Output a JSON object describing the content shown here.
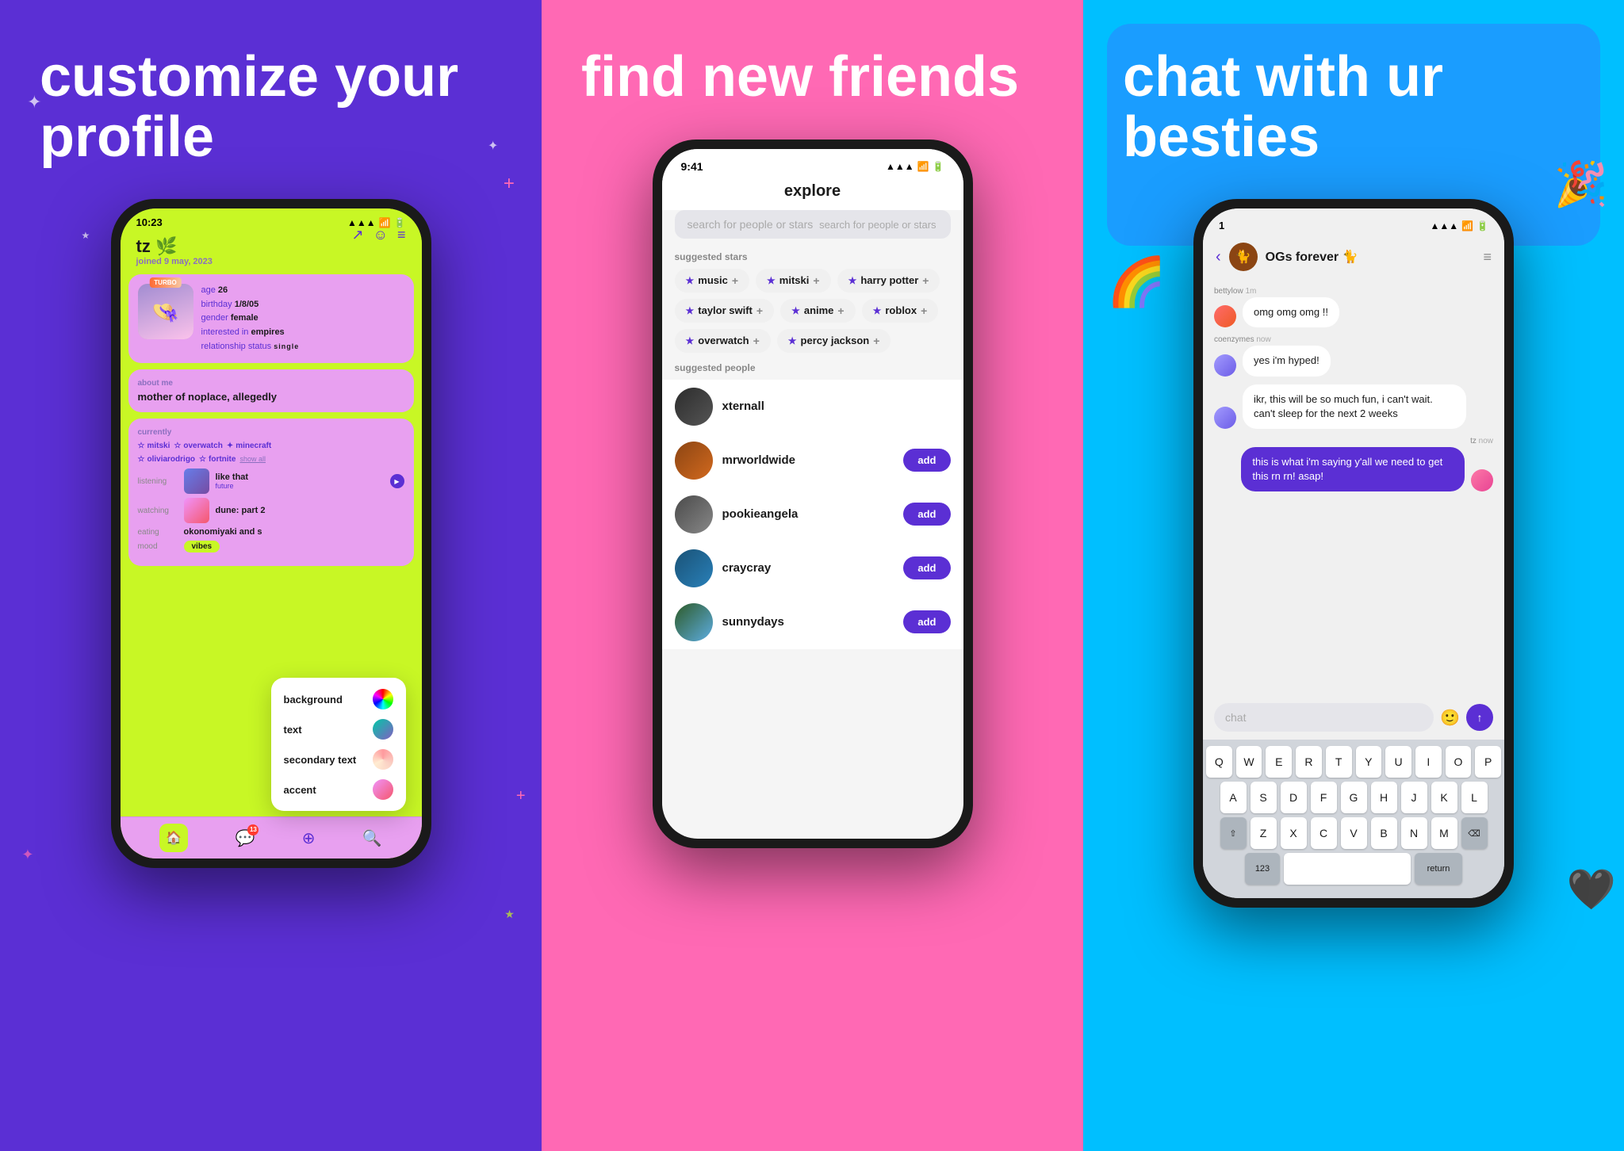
{
  "panel1": {
    "title": "customize your profile",
    "phone": {
      "time": "10:23",
      "username": "tz 🌿",
      "joined": "joined 9 may, 2023",
      "profile": {
        "badge": "TURBO",
        "age": "26",
        "birthday": "1/8/05",
        "gender": "female",
        "interested_in": "empires",
        "relationship_status": "single"
      },
      "about_label": "about me",
      "about_text": "mother of noplace, allegedly",
      "currently_label": "currently",
      "tags": [
        "mitski",
        "overwatch",
        "minecraft",
        "oliviarodrigo",
        "fortnite"
      ],
      "show_all": "show all",
      "listening_label": "listening",
      "listening_track": "like that",
      "listening_artist": "future",
      "watching_label": "watching",
      "watching_title": "dune: part 2",
      "eating_label": "eating",
      "eating_text": "okonomiyaki and s",
      "mood_label": "mood",
      "mood_text": "vibes",
      "dropdown": {
        "items": [
          "background",
          "text",
          "secondary text",
          "accent"
        ],
        "colors": [
          "gradient-multi",
          "gradient-green",
          "gradient-multi2",
          "gradient-pink"
        ]
      }
    }
  },
  "panel2": {
    "title": "find new friends",
    "phone": {
      "time": "9:41",
      "screen_title": "explore",
      "search_placeholder": "search for people or stars",
      "suggested_stars_label": "suggested stars",
      "tags": [
        "music",
        "mitski",
        "harry potter",
        "taylor swift",
        "anime",
        "roblox",
        "overwatch",
        "percy jackson"
      ],
      "suggested_people_label": "suggested people",
      "people": [
        {
          "name": "xternall",
          "has_add": false
        },
        {
          "name": "mrworldwide",
          "has_add": true
        },
        {
          "name": "pookieangela",
          "has_add": true
        },
        {
          "name": "craycray",
          "has_add": true
        },
        {
          "name": "sunnydays",
          "has_add": true
        }
      ],
      "add_label": "add"
    }
  },
  "panel3": {
    "title": "chat with ur besties",
    "phone": {
      "time": "1",
      "group_name": "OGs forever 🐈",
      "messages": [
        {
          "user": "bettylow",
          "time": "1m",
          "text": "omg omg omg !!",
          "outgoing": false
        },
        {
          "user": "coenzymes",
          "time": "now",
          "text": "yes i'm hyped!",
          "outgoing": false
        },
        {
          "user": "coenzymes",
          "time": "",
          "text": "ikr, this will be so much fun, i can't wait. can't sleep for the next 2 weeks",
          "outgoing": false
        },
        {
          "user": "tz",
          "time": "now",
          "text": "this is what i'm saying y'all we need to get this rn rn! asap!",
          "outgoing": true
        }
      ],
      "chat_placeholder": "chat",
      "keyboard_rows": [
        [
          "Q",
          "W",
          "E",
          "R",
          "T",
          "Y",
          "U",
          "I",
          "O",
          "P"
        ],
        [
          "A",
          "S",
          "D",
          "F",
          "G",
          "H",
          "J",
          "K",
          "L"
        ],
        [
          "⇧",
          "Z",
          "X",
          "C",
          "V",
          "B",
          "N",
          "M",
          "⌫"
        ],
        [
          "123",
          " ",
          "return"
        ]
      ]
    }
  }
}
